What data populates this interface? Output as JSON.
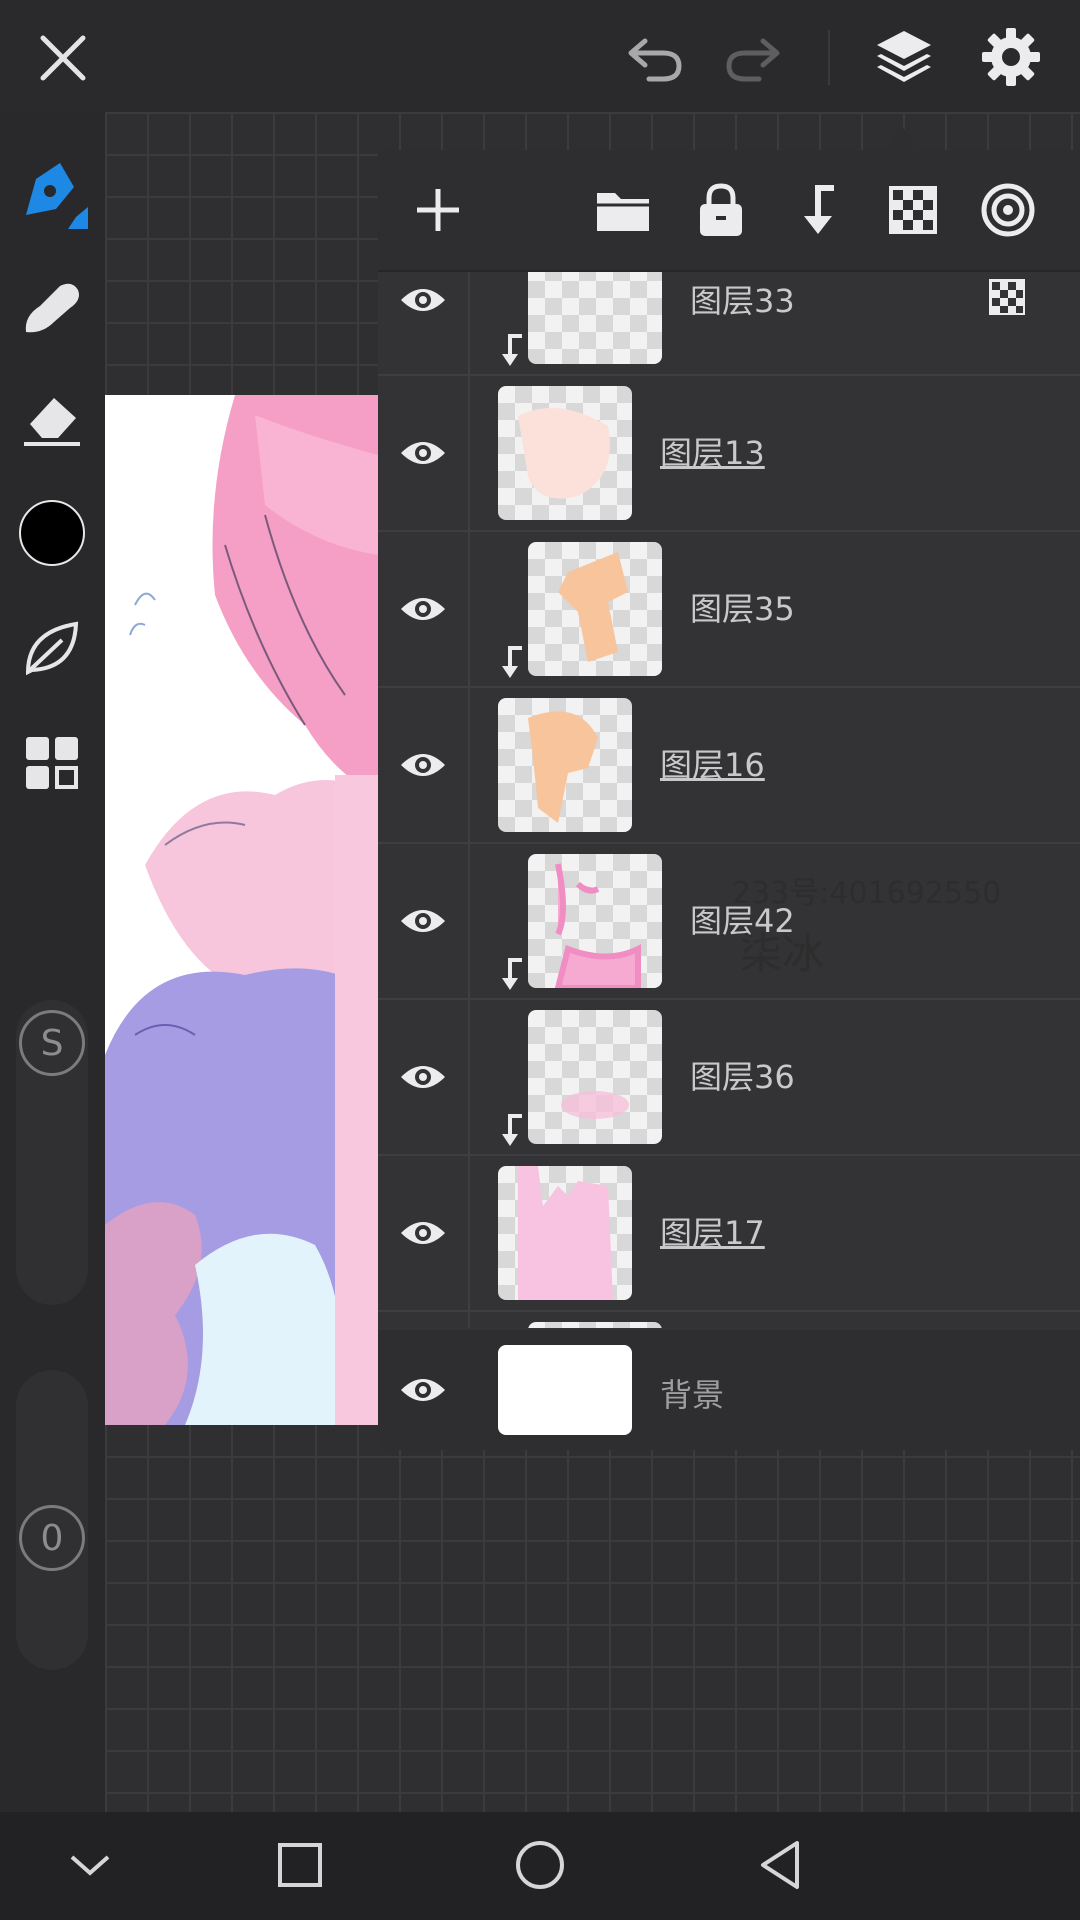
{
  "layers": [
    {
      "name": "图层33",
      "clipped": true,
      "underline": false
    },
    {
      "name": "图层13",
      "clipped": false,
      "underline": true
    },
    {
      "name": "图层35",
      "clipped": true,
      "underline": false
    },
    {
      "name": "图层16",
      "clipped": false,
      "underline": true
    },
    {
      "name": "图层42",
      "clipped": true,
      "underline": false
    },
    {
      "name": "图层36",
      "clipped": true,
      "underline": false
    },
    {
      "name": "图层17",
      "clipped": false,
      "underline": true
    }
  ],
  "background_layer": {
    "name": "背景"
  },
  "watermark": {
    "line1": "233号:401692550",
    "line2": "柒冰"
  },
  "left_tools": {
    "s_label": "S",
    "zero_label": "0"
  },
  "colors": {
    "accent": "#1e88e5",
    "current_color": "#000000"
  }
}
